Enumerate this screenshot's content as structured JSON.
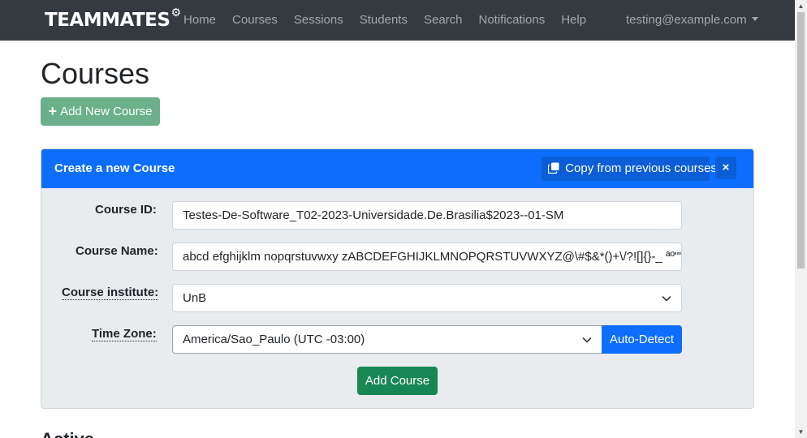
{
  "navbar": {
    "brand": "TEAMMATES",
    "links": [
      "Home",
      "Courses",
      "Sessions",
      "Students",
      "Search",
      "Notifications",
      "Help"
    ],
    "user": "testing@example.com"
  },
  "page": {
    "title": "Courses",
    "add_new_label": "Add New Course",
    "next_heading": "Active"
  },
  "card": {
    "title": "Create a new Course",
    "copy_label": "Copy from previous courses",
    "close_label": "×"
  },
  "form": {
    "course_id_label": "Course ID:",
    "course_id_value": "Testes-De-Software_T02-2023-Universidade.De.Brasilia$2023--01-SM",
    "course_name_label": "Course Name:",
    "course_name_value": "abcd efghijklm nopqrstuvwxy zABCDEFGHIJKLMNOPQRSTUVWXYZ@\\#$&*()+\\/?![]{}-_ ªº\"\"",
    "institute_label": "Course institute:",
    "institute_value": "UnB",
    "timezone_label": "Time Zone:",
    "timezone_value": "America/Sao_Paulo (UTC -03:00)",
    "auto_detect_label": "Auto-Detect",
    "submit_label": "Add Course"
  },
  "icons": {
    "brand_gear": "gear-icon",
    "plus": "plus-icon",
    "copy": "copy-icon",
    "chevron": "chevron-down-icon"
  },
  "colors": {
    "navbar": "#343a40",
    "primary": "#0d6efd",
    "success": "#198754",
    "success_light": "#6bb08b",
    "card_body": "#e9ecef"
  }
}
